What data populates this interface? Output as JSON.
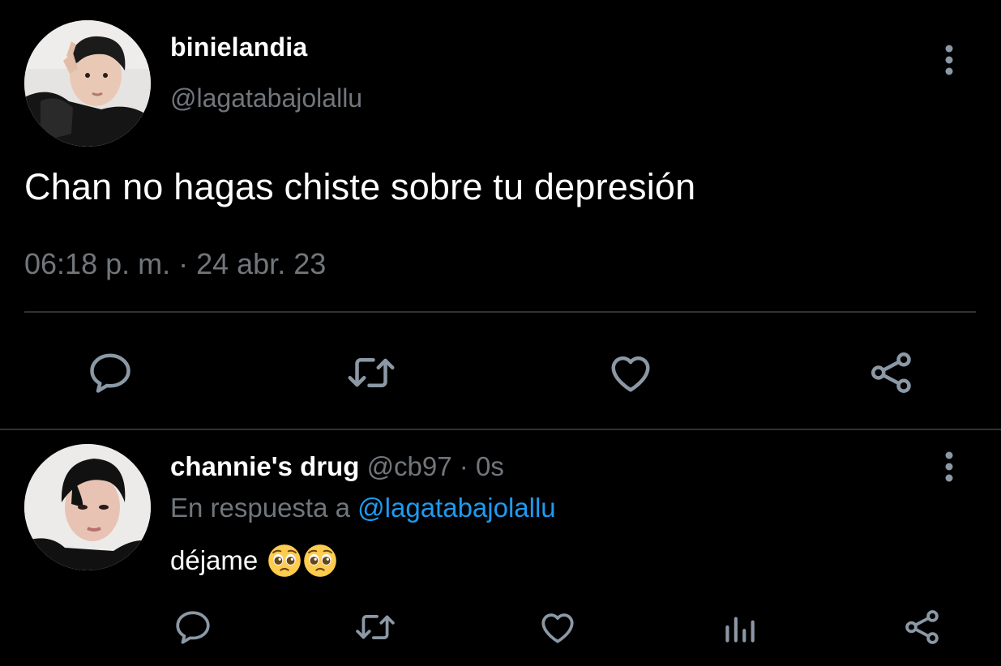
{
  "main_tweet": {
    "display_name": "binielandia",
    "handle": "@lagatabajolallu",
    "text": "Chan no hagas chiste sobre tu depresión",
    "timestamp": "06:18 p. m. · 24 abr. 23",
    "avatar": "profile-photo",
    "more_icon": "more-vertical-icon",
    "actions": [
      {
        "name": "reply",
        "icon": "comment-icon"
      },
      {
        "name": "retweet",
        "icon": "retweet-icon"
      },
      {
        "name": "like",
        "icon": "heart-icon"
      },
      {
        "name": "share",
        "icon": "share-icon"
      }
    ]
  },
  "reply_tweet": {
    "display_name": "channie's drug",
    "handle": "@cb97",
    "separator": "·",
    "age": "0s",
    "replying_to_prefix": "En respuesta a",
    "replying_to_handle": "@lagatabajolallu",
    "text": "déjame",
    "emojis": [
      "pleading-face",
      "pleading-face"
    ],
    "avatar": "profile-photo",
    "more_icon": "more-vertical-icon",
    "actions": [
      {
        "name": "reply",
        "icon": "comment-icon"
      },
      {
        "name": "retweet",
        "icon": "retweet-icon"
      },
      {
        "name": "like",
        "icon": "heart-icon"
      },
      {
        "name": "views",
        "icon": "analytics-icon"
      },
      {
        "name": "share",
        "icon": "share-icon"
      }
    ]
  },
  "colors": {
    "background": "#000000",
    "primary_text": "#ffffff",
    "secondary_text": "#71767b",
    "link": "#1d9bf0",
    "divider": "#2f3336",
    "icon": "#8b98a5"
  }
}
